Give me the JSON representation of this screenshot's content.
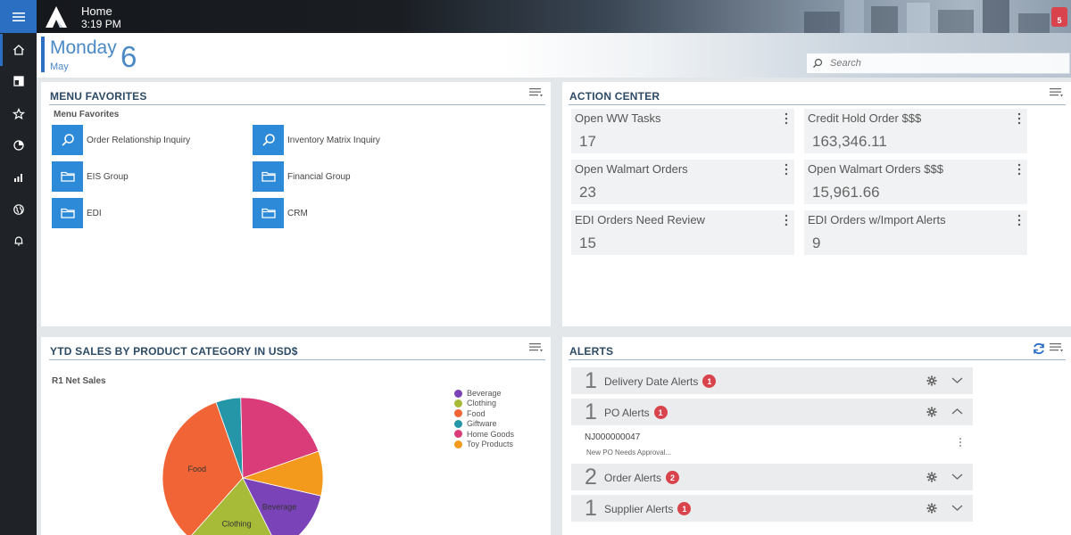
{
  "header": {
    "title": "Home",
    "time": "3:19 PM",
    "notification_count": "5"
  },
  "date": {
    "weekday": "Monday",
    "month": "May",
    "day": "6"
  },
  "search": {
    "placeholder": "Search"
  },
  "rail": {
    "items": [
      "home-icon",
      "dashboard-icon",
      "star-icon",
      "clock-chart-icon",
      "bar-chart-icon",
      "globe-icon",
      "bell-icon"
    ]
  },
  "menu_favorites": {
    "title": "MENU FAVORITES",
    "subtitle": "Menu Favorites",
    "items": [
      {
        "label": "Order Relationship Inquiry",
        "icon": "search-icon"
      },
      {
        "label": "Inventory Matrix Inquiry",
        "icon": "search-icon"
      },
      {
        "label": "EIS Group",
        "icon": "folder-icon"
      },
      {
        "label": "Financial Group",
        "icon": "folder-icon"
      },
      {
        "label": "EDI",
        "icon": "folder-icon"
      },
      {
        "label": "CRM",
        "icon": "folder-icon"
      }
    ]
  },
  "action_center": {
    "title": "ACTION CENTER",
    "tiles": [
      {
        "label": "Open WW Tasks",
        "value": "17"
      },
      {
        "label": "Credit Hold Order $$$",
        "value": "163,346.11"
      },
      {
        "label": "Open Walmart Orders",
        "value": "23"
      },
      {
        "label": "Open Walmart Orders $$$",
        "value": "15,961.66"
      },
      {
        "label": "EDI Orders Need Review",
        "value": "15"
      },
      {
        "label": "EDI Orders w/Import Alerts",
        "value": "9"
      }
    ]
  },
  "sales_chart": {
    "title": "YTD SALES BY PRODUCT CATEGORY IN USD$",
    "subtitle": "R1 Net Sales"
  },
  "chart_data": {
    "type": "pie",
    "title": "R1 Net Sales",
    "legend_position": "top-right",
    "slices": [
      {
        "name": "Beverage",
        "value": 14,
        "color": "#7b43b8",
        "label": "Beverage"
      },
      {
        "name": "Clothing",
        "value": 19,
        "color": "#a8bb38",
        "label": "Clothing"
      },
      {
        "name": "Food",
        "value": 33,
        "color": "#f06436",
        "label": "Food"
      },
      {
        "name": "Giftware",
        "value": 5,
        "color": "#2596a8",
        "label": ""
      },
      {
        "name": "Home Goods",
        "value": 20,
        "color": "#d93c79",
        "label": ""
      },
      {
        "name": "Toy Products",
        "value": 9,
        "color": "#f39a1c",
        "label": ""
      }
    ]
  },
  "alerts": {
    "title": "ALERTS",
    "rows": [
      {
        "count": "1",
        "label": "Delivery Date Alerts",
        "badge": "1",
        "expanded": false
      },
      {
        "count": "1",
        "label": "PO Alerts",
        "badge": "1",
        "expanded": true,
        "detail": {
          "id": "NJ000000047",
          "description": "New PO Needs Approval..."
        }
      },
      {
        "count": "2",
        "label": "Order Alerts",
        "badge": "2",
        "expanded": false
      },
      {
        "count": "1",
        "label": "Supplier Alerts",
        "badge": "1",
        "expanded": false
      }
    ]
  },
  "colors": {
    "accent": "#2b6fc2",
    "tile_blue": "#2d8ad8",
    "badge_red": "#d9434b",
    "rail": "#1f2327"
  }
}
